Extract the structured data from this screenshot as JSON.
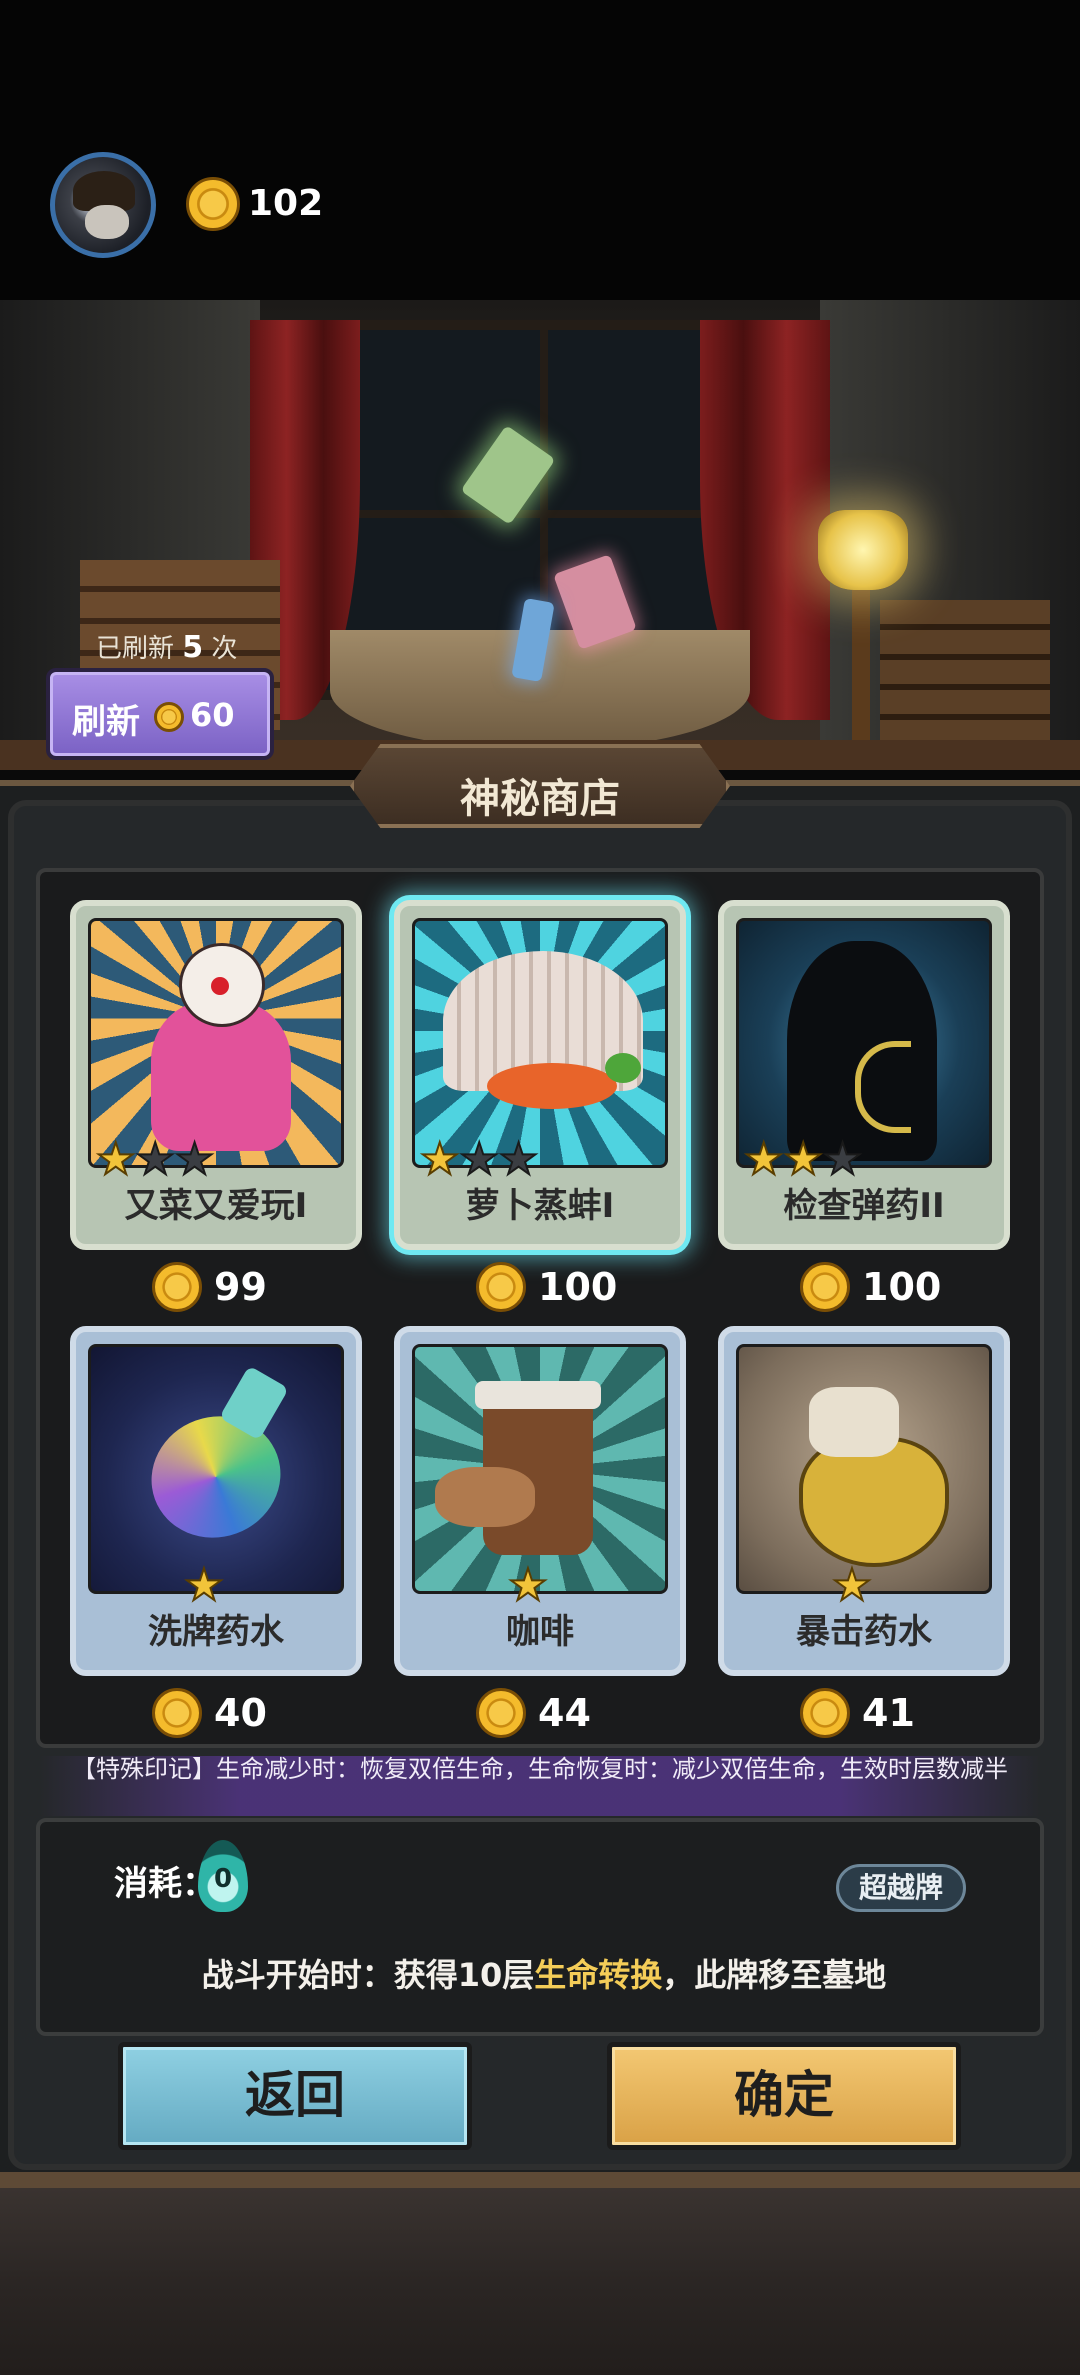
{
  "header": {
    "coins": "102"
  },
  "refresh": {
    "count_prefix": "已刷新",
    "count": "5",
    "count_suffix": "次",
    "label": "刷新",
    "price": "60"
  },
  "shop": {
    "title": "神秘商店",
    "items": [
      {
        "name": "又菜又爱玩I",
        "price": "99",
        "stars": 1,
        "max_stars": 3,
        "selected": false
      },
      {
        "name": "萝卜蒸蚌I",
        "price": "100",
        "stars": 1,
        "max_stars": 3,
        "selected": true
      },
      {
        "name": "检查弹药II",
        "price": "100",
        "stars": 2,
        "max_stars": 3,
        "selected": false
      },
      {
        "name": "洗牌药水",
        "price": "40",
        "stars": 1,
        "max_stars": 1,
        "selected": false
      },
      {
        "name": "咖啡",
        "price": "44",
        "stars": 1,
        "max_stars": 1,
        "selected": false
      },
      {
        "name": "暴击药水",
        "price": "41",
        "stars": 1,
        "max_stars": 1,
        "selected": false
      }
    ]
  },
  "detail": {
    "special_mark": "【特殊印记】生命减少时：恢复双倍生命，生命恢复时：减少双倍生命，生效时层数减半",
    "cost_label": "消耗：",
    "cost_value": "0",
    "tag": "超越牌",
    "effect_before": "战斗开始时：获得10层",
    "effect_keyword": "生命转换",
    "effect_after": "，此牌移至墓地"
  },
  "buttons": {
    "back": "返回",
    "confirm": "确定"
  },
  "colors": {
    "accent_gold": "#f4cd58",
    "selected_glow": "#6fe9f2",
    "refresh_purple": "#9b82de",
    "back_blue": "#7cc0d6",
    "confirm_gold": "#e6b35c"
  }
}
